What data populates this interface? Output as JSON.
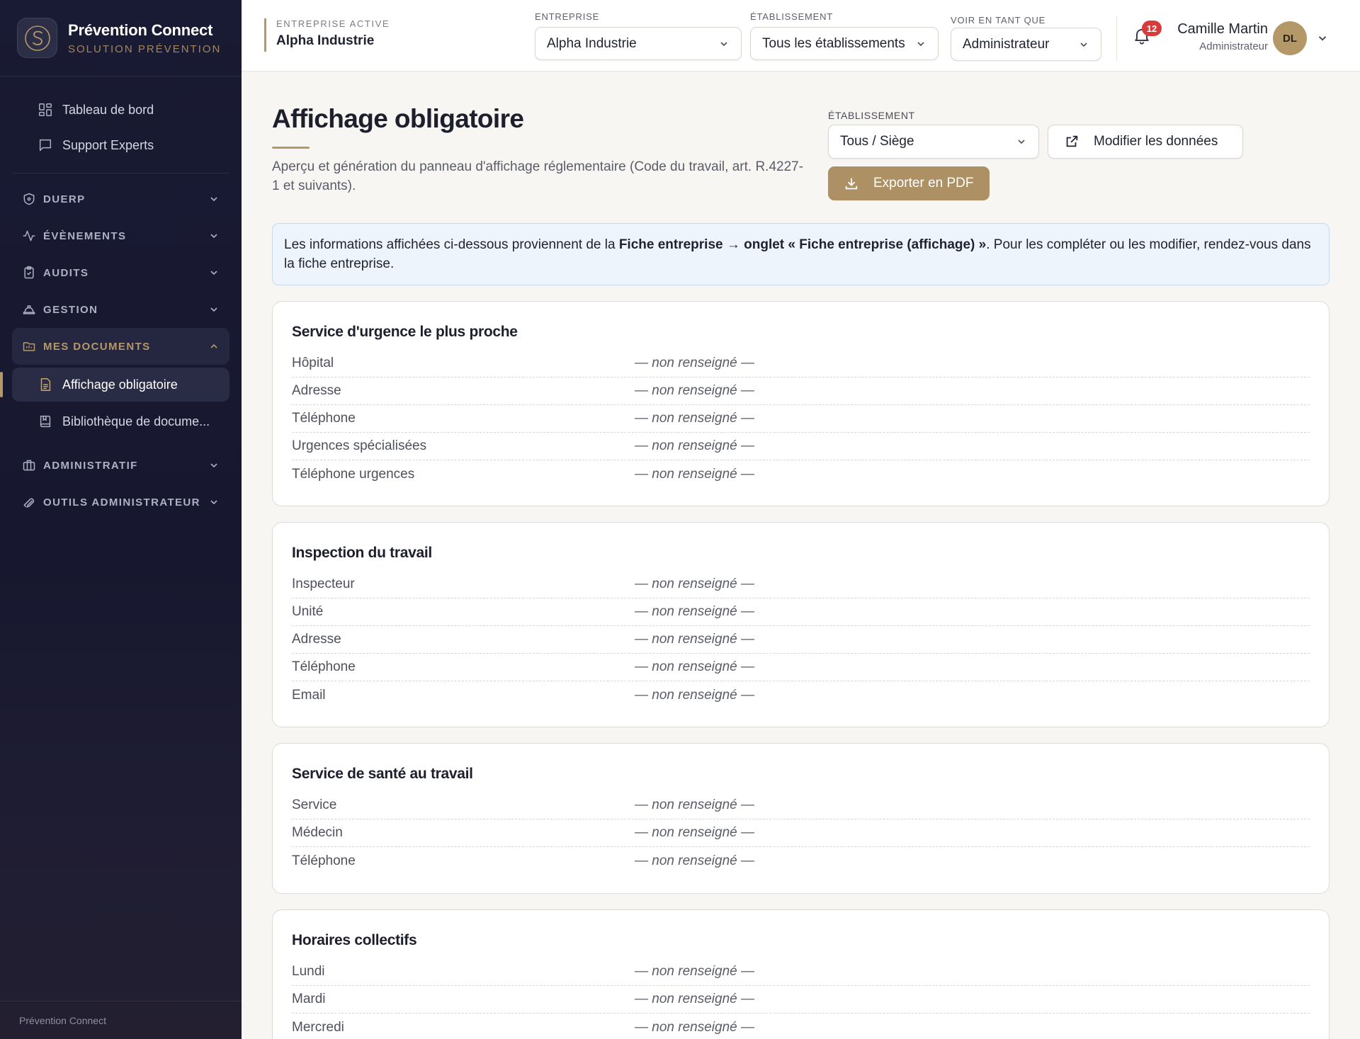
{
  "brand": {
    "name": "Prévention Connect",
    "tagline": "SOLUTION PRÉVENTION"
  },
  "sidebar": {
    "top_items": [
      {
        "label": "Tableau de bord",
        "icon": "dashboard-grid-icon"
      },
      {
        "label": "Support Experts",
        "icon": "chat-bubble-icon"
      }
    ],
    "sections": [
      {
        "label": "DUERP",
        "icon": "shield-icon",
        "expanded": false
      },
      {
        "label": "ÉVÈNEMENTS",
        "icon": "activity-pulse-icon",
        "expanded": false
      },
      {
        "label": "AUDITS",
        "icon": "clipboard-check-icon",
        "expanded": false
      },
      {
        "label": "GESTION",
        "icon": "hard-hat-icon",
        "expanded": false
      },
      {
        "label": "MES DOCUMENTS",
        "icon": "folder-icon",
        "expanded": true,
        "items": [
          {
            "label": "Affichage obligatoire",
            "icon": "document-icon",
            "active": true
          },
          {
            "label": "Bibliothèque de docume...",
            "icon": "book-icon",
            "active": false
          }
        ]
      },
      {
        "label": "ADMINISTRATIF",
        "icon": "briefcase-icon",
        "expanded": false
      },
      {
        "label": "OUTILS ADMINISTRATEUR",
        "icon": "wrench-icon",
        "expanded": false
      }
    ],
    "footer": "Prévention Connect"
  },
  "header": {
    "active_company": {
      "label": "ENTREPRISE ACTIVE",
      "value": "Alpha Industrie"
    },
    "company_select": {
      "label": "ENTREPRISE",
      "value": "Alpha Industrie"
    },
    "site_select": {
      "label": "ÉTABLISSEMENT",
      "value": "Tous les établissements"
    },
    "view_as_select": {
      "label": "VOIR EN TANT QUE",
      "value": "Administrateur"
    },
    "notifications_count": "12",
    "user": {
      "name": "Camille Martin",
      "role": "Administrateur",
      "initials": "DL"
    }
  },
  "page": {
    "title": "Affichage obligatoire",
    "description": "Aperçu et génération du panneau d'affichage réglementaire (Code du travail, art. R.4227-1 et suivants).",
    "site_filter": {
      "label": "ÉTABLISSEMENT",
      "value": "Tous / Siège"
    },
    "edit_button": "Modifier les données",
    "export_button": "Exporter en PDF",
    "info": {
      "prefix": "Les informations affichées ci-dessous proviennent de la ",
      "strong": "Fiche entreprise → onglet « Fiche entreprise (affichage) »",
      "suffix": ". Pour les compléter ou les modifier, rendez-vous dans la fiche entreprise."
    }
  },
  "cards": [
    {
      "title": "Service d'urgence le plus proche",
      "rows": [
        {
          "label": "Hôpital",
          "value": "— non renseigné —"
        },
        {
          "label": "Adresse",
          "value": "— non renseigné —"
        },
        {
          "label": "Téléphone",
          "value": "— non renseigné —"
        },
        {
          "label": "Urgences spécialisées",
          "value": "— non renseigné —"
        },
        {
          "label": "Téléphone urgences",
          "value": "— non renseigné —"
        }
      ]
    },
    {
      "title": "Inspection du travail",
      "rows": [
        {
          "label": "Inspecteur",
          "value": "— non renseigné —"
        },
        {
          "label": "Unité",
          "value": "— non renseigné —"
        },
        {
          "label": "Adresse",
          "value": "— non renseigné —"
        },
        {
          "label": "Téléphone",
          "value": "— non renseigné —"
        },
        {
          "label": "Email",
          "value": "— non renseigné —"
        }
      ]
    },
    {
      "title": "Service de santé au travail",
      "rows": [
        {
          "label": "Service",
          "value": "— non renseigné —"
        },
        {
          "label": "Médecin",
          "value": "— non renseigné —"
        },
        {
          "label": "Téléphone",
          "value": "— non renseigné —"
        }
      ]
    },
    {
      "title": "Horaires collectifs",
      "rows": [
        {
          "label": "Lundi",
          "value": "— non renseigné —"
        },
        {
          "label": "Mardi",
          "value": "— non renseigné —"
        },
        {
          "label": "Mercredi",
          "value": "— non renseigné —"
        }
      ]
    }
  ],
  "colors": {
    "accent": "#b59868",
    "sidebar_bg": "#191a33",
    "notification_badge": "#d93a3a",
    "info_bg": "#eef4fb"
  }
}
